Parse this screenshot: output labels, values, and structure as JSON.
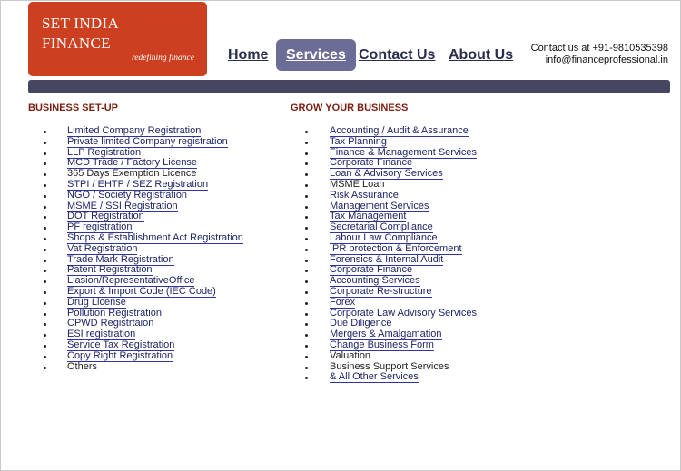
{
  "header": {
    "logo_line1": "SET INDIA",
    "logo_line2": "FINANCE",
    "logo_tagline": "redefining finance",
    "contact_phone": "Contact us at +91-9810535398",
    "contact_email": "info@financeprofessional.in"
  },
  "nav": {
    "items": [
      {
        "label": "Home"
      },
      {
        "label": "Services"
      },
      {
        "label": "Contact Us"
      },
      {
        "label": "About Us"
      }
    ],
    "active": "Services"
  },
  "left_column": {
    "heading": "BUSINESS SET-UP",
    "items": [
      {
        "label": "Limited Company Registration",
        "link": true
      },
      {
        "label": "Private limited Company registration",
        "link": true
      },
      {
        "label": "LLP Registration",
        "link": true
      },
      {
        "label": "MCD Trade / Factory License",
        "link": true
      },
      {
        "label": "365 Days Exemption Licence",
        "link": false
      },
      {
        "label": "STPI / EHTP / SEZ Registration",
        "link": true
      },
      {
        "label": "NGO / Society Registration",
        "link": true
      },
      {
        "label": "MSME / SSI Registration",
        "link": true
      },
      {
        "label": "DOT Registration",
        "link": true
      },
      {
        "label": "PF registration",
        "link": true
      },
      {
        "label": "Shops & Establishment Act Registration",
        "link": true
      },
      {
        "label": "Vat Registration",
        "link": true
      },
      {
        "label": "Trade Mark Registration",
        "link": true
      },
      {
        "label": "Patent Registration",
        "link": true
      },
      {
        "label": "Liasion/RepresentativeOffice",
        "link": true
      },
      {
        "label": "Export & Import Code (IEC Code)",
        "link": true
      },
      {
        "label": "Drug License",
        "link": true
      },
      {
        "label": "Pollution Registration",
        "link": true
      },
      {
        "label": "CPWD Registrtaion",
        "link": true
      },
      {
        "label": "ESI registration",
        "link": true
      },
      {
        "label": "Service Tax Registration",
        "link": true
      },
      {
        "label": "Copy Right Registration",
        "link": true
      },
      {
        "label": "Others",
        "link": false
      }
    ]
  },
  "right_column": {
    "heading": "GROW YOUR BUSINESS",
    "items": [
      {
        "label": "Accounting / Audit & Assurance",
        "link": true
      },
      {
        "label": "Tax Planning",
        "link": true
      },
      {
        "label": "Finance & Management Services",
        "link": true
      },
      {
        "label": "Corporate Finance",
        "link": true
      },
      {
        "label": "Loan & Advisory Services",
        "link": true
      },
      {
        "label": "MSME Loan",
        "link": false
      },
      {
        "label": "Risk Assurance",
        "link": true
      },
      {
        "label": "Management Services",
        "link": true
      },
      {
        "label": "Tax Management",
        "link": true
      },
      {
        "label": "Secretarial Compliance",
        "link": true
      },
      {
        "label": "Labour Law Compliance",
        "link": true
      },
      {
        "label": "IPR protection & Enforcement",
        "link": true
      },
      {
        "label": "Forensics & Internal Audit",
        "link": true
      },
      {
        "label": "Corporate Finance",
        "link": true
      },
      {
        "label": "Accounting Services",
        "link": true
      },
      {
        "label": "Corporate Re-structure",
        "link": true
      },
      {
        "label": "Forex",
        "link": true
      },
      {
        "label": "Corporate Law Advisory Services",
        "link": true
      },
      {
        "label": "Due Diligence",
        "link": true
      },
      {
        "label": "Mergers & Amalgamation",
        "link": true
      },
      {
        "label": "Change Business Form",
        "link": true
      },
      {
        "label": "Valuation",
        "link": false
      },
      {
        "label": "Business Support Services",
        "link": false
      },
      {
        "label": "& All Other Services",
        "link": true
      }
    ]
  },
  "colors": {
    "logo_bg": "#cc3f20",
    "nav_active_bg": "#6b6d96",
    "bar": "#45465f",
    "heading": "#7a1f0f",
    "link": "#1f2466"
  }
}
